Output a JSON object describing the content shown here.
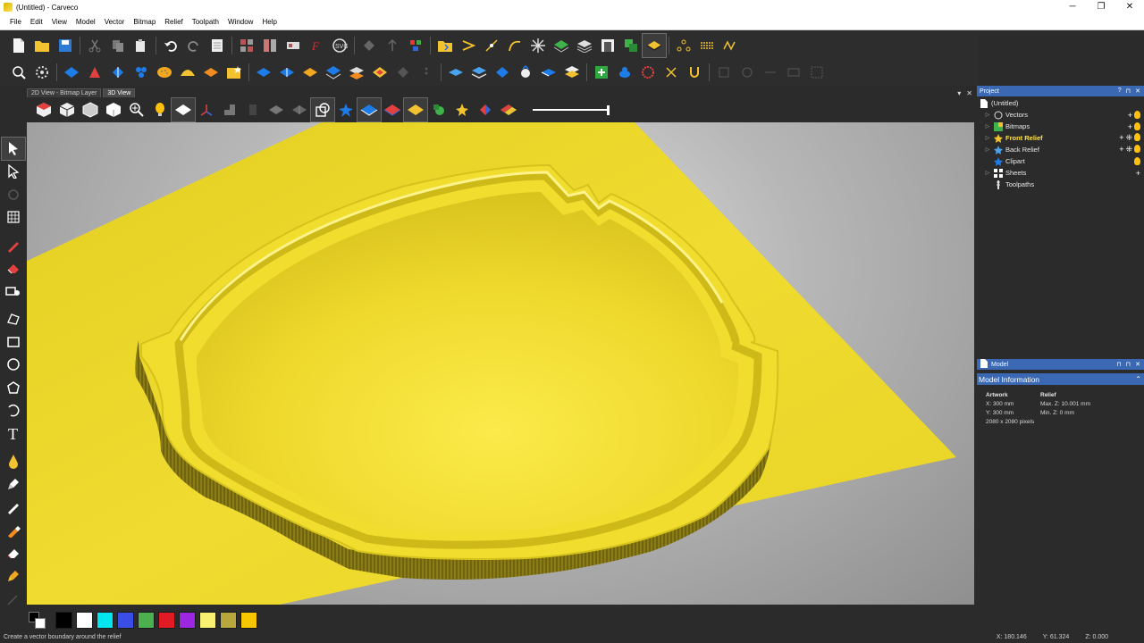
{
  "window": {
    "title": "(Untitled) - Carveco",
    "minimize": "─",
    "maximize": "❐",
    "close": "✕"
  },
  "menu": [
    "File",
    "Edit",
    "View",
    "Model",
    "Vector",
    "Bitmap",
    "Relief",
    "Toolpath",
    "Window",
    "Help"
  ],
  "view_tabs": {
    "tab_2d": "2D View - Bitmap Layer",
    "tab_3d": "3D View",
    "dropdown": "▾",
    "close": "✕"
  },
  "project_panel": {
    "title": "Project",
    "buttons": [
      "?",
      "⊓",
      "✕"
    ],
    "root": "(Untitled)",
    "items": [
      {
        "label": "Vectors",
        "arrow": "▷",
        "icon": "vector-layers-icon",
        "selected": false
      },
      {
        "label": "Bitmaps",
        "arrow": "▷",
        "icon": "bitmaps-icon",
        "selected": false
      },
      {
        "label": "Front Relief",
        "arrow": "▷",
        "icon": "relief-star-icon",
        "selected": true
      },
      {
        "label": "Back Relief",
        "arrow": "▷",
        "icon": "relief-star-icon",
        "selected": false
      },
      {
        "label": "Clipart",
        "arrow": "",
        "icon": "clipart-star-icon",
        "selected": false
      },
      {
        "label": "Sheets",
        "arrow": "▷",
        "icon": "sheets-icon",
        "selected": false
      },
      {
        "label": "Toolpaths",
        "arrow": "",
        "icon": "toolpaths-icon",
        "selected": false
      }
    ]
  },
  "model_panel": {
    "title": "Model",
    "buttons": [
      "⊓",
      "⊓",
      "✕"
    ],
    "info_title": "Model Information",
    "chevron": "⌃",
    "artwork_heading": "Artwork",
    "relief_heading": "Relief",
    "x": "X: 300 mm",
    "y": "Y: 300 mm",
    "pixels": "2080 x 2080 pixels",
    "max_z": "Max. Z: 10.001 mm",
    "min_z": "Min. Z: 0 mm"
  },
  "palette": [
    "#000000",
    "#ffffff",
    "#00e5ee",
    "#3a4ee6",
    "#4caf50",
    "#e01b24",
    "#9c27e0",
    "#f9ef70",
    "#b6a63c",
    "#f7c600"
  ],
  "status": {
    "message": "Create a vector boundary around the relief",
    "x": "X: 180.146",
    "y": "Y: 61.324",
    "z": "Z: 0.000"
  },
  "colors": {
    "accent": "#3b68b2",
    "relief": "#f1de2c",
    "selected_text": "#ffe24a"
  }
}
